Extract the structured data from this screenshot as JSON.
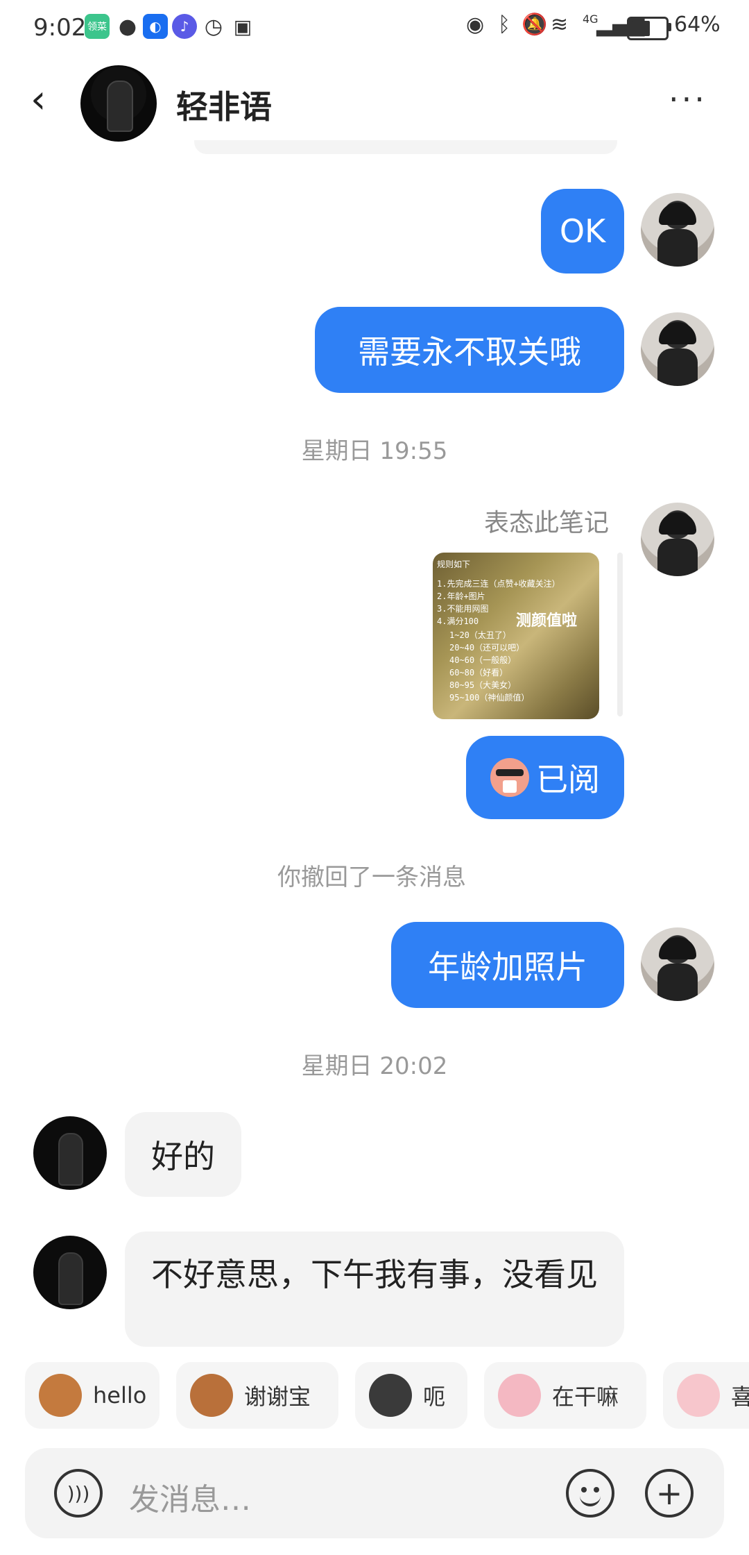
{
  "status_bar": {
    "time": "9:02",
    "notif_badge": "领菜",
    "signal": "4G",
    "battery_text": "64%",
    "battery_level": 0.64
  },
  "header": {
    "title": "轻非语"
  },
  "messages": {
    "m1": "OK",
    "m2": "需要永不取关哦",
    "ts1": "星期日 19:55",
    "note_label": "表态此笔记",
    "note_card": {
      "lines": [
        "规则如下",
        "1.先完成三连（点赞+收藏关注）",
        "2.年龄+图片",
        "3.不能用网图",
        "4.满分100",
        "1~20（太丑了）",
        "20~40（还可以吧）",
        "40~60（一般般）",
        "60~80（好看）",
        "80~95（大美女）",
        "95~100（神仙颜值）"
      ],
      "badge": "测颜值啦"
    },
    "m3": "已阅",
    "recall": "你撤回了一条消息",
    "m4": "年龄加照片",
    "ts2": "星期日 20:02",
    "r1": "好的",
    "r2": "不好意思，下午我有事，没看见"
  },
  "quick_replies": [
    "hello",
    "谢谢宝",
    "呃",
    "在干嘛",
    "喜"
  ],
  "input": {
    "placeholder": "发消息…"
  }
}
